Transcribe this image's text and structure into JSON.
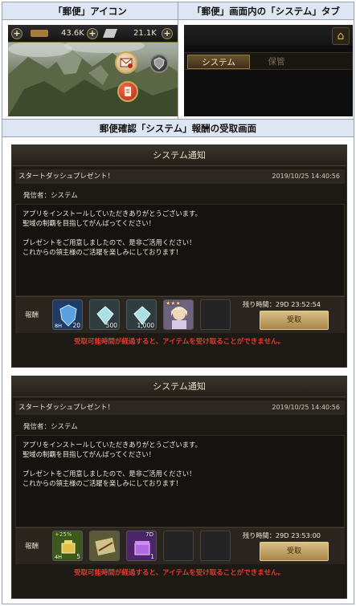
{
  "table_headers": {
    "mail_icon": "「郵便」アイコン",
    "system_tab": "「郵便」画面内の「システム」タブ",
    "reward_screen": "郵便確認「システム」報酬の受取画面"
  },
  "game_top": {
    "resource1": "43.6K",
    "resource2": "21.1K",
    "plus": "+"
  },
  "mail_tabs": {
    "system": "システム",
    "keep": "保管",
    "home_icon": "home-icon"
  },
  "panels": [
    {
      "title": "システム通知",
      "subject": "スタートダッシュプレゼント！",
      "date": "2019/10/25 14:40:56",
      "sender": "発信者：システム",
      "body": [
        "アプリをインストールしていただきありがとうございます。",
        "聖域の制覇を目指してがんばってください！",
        "",
        "プレゼントをご用意しましたので、是非ご活用ください！",
        "これからの領主様のご活躍を楽しみにしております！"
      ],
      "reward_label": "報酬",
      "remaining": "残り時間：29D 23:52:54",
      "claim": "受取",
      "warning": "受取可能時間が経過すると、アイテムを受け取ることができません。",
      "items": [
        {
          "icon": "blue-crystal-shield-icon",
          "tag": "",
          "tag_bottom": "8H",
          "qty": "20",
          "color": "#3a6fb0"
        },
        {
          "icon": "diamond-icon",
          "tag": "",
          "tag_bottom": "",
          "qty": "500",
          "color": "#4a6f78"
        },
        {
          "icon": "diamond-icon",
          "tag": "",
          "tag_bottom": "",
          "qty": "1,000",
          "color": "#4a6f78"
        },
        {
          "icon": "hero-portrait-icon",
          "tag": "★★★",
          "tag_bottom": "",
          "qty": "",
          "color": "#8a7a9a"
        },
        {
          "icon": "empty-slot",
          "tag": "",
          "tag_bottom": "",
          "qty": "",
          "color": ""
        }
      ]
    },
    {
      "title": "システム通知",
      "subject": "スタートダッシュプレゼント！",
      "date": "2019/10/25 14:40:56",
      "sender": "発信者：システム",
      "body": [
        "アプリをインストールしていただきありがとうございます。",
        "聖域の制覇を目指してがんばってください！",
        "",
        "プレゼントをご用意しましたので、是非ご活用ください！",
        "これからの領主様のご活躍を楽しみにしております！"
      ],
      "reward_label": "報酬",
      "remaining": "残り時間：29D 23:53:00",
      "claim": "受取",
      "warning": "受取可能時間が経過すると、アイテムを受け取ることができません。",
      "items": [
        {
          "icon": "gold-boost-icon",
          "tag": "+25%",
          "tag_bottom": "4H",
          "qty": "5",
          "color": "#5f8a2a"
        },
        {
          "icon": "map-scroll-icon",
          "tag": "",
          "tag_bottom": "",
          "qty": "",
          "color": "#7a7a4a"
        },
        {
          "icon": "purple-chest-icon",
          "tag": "7D",
          "tag_bottom": "",
          "qty": "1",
          "color": "#7a3aa0"
        },
        {
          "icon": "empty-slot",
          "tag": "",
          "tag_bottom": "",
          "qty": "",
          "color": ""
        },
        {
          "icon": "empty-slot",
          "tag": "",
          "tag_bottom": "",
          "qty": "",
          "color": ""
        }
      ]
    }
  ]
}
